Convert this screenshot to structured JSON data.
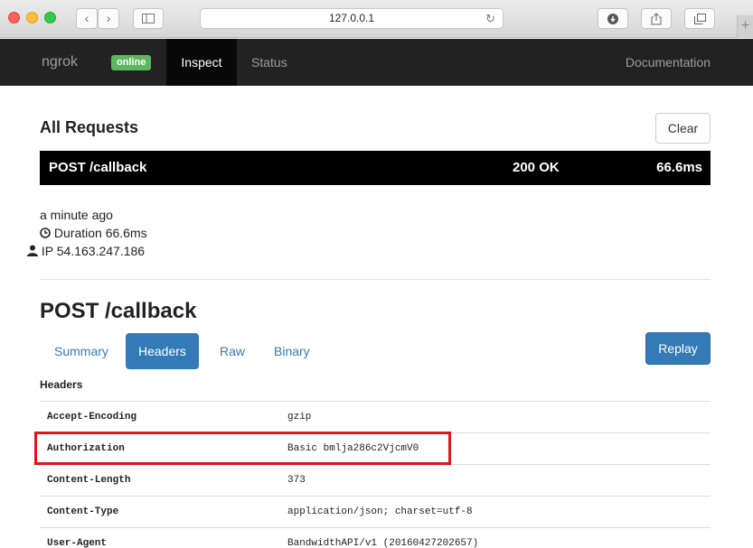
{
  "browser": {
    "address": "127.0.0.1",
    "icons": [
      "back-icon",
      "forward-icon",
      "sidebar-icon",
      "reload-icon",
      "download-icon",
      "share-icon",
      "tabs-icon",
      "new-tab-icon"
    ]
  },
  "navbar": {
    "brand": "ngrok",
    "status_badge": "online",
    "tabs": [
      "Inspect",
      "Status"
    ],
    "docs": "Documentation"
  },
  "requests": {
    "title": "All Requests",
    "clear_label": "Clear",
    "row": {
      "method_path": "POST /callback",
      "status": "200 OK",
      "duration": "66.6ms"
    },
    "time_ago": "a minute ago",
    "duration_line": "Duration  66.6ms",
    "ip_line": "IP  54.163.247.186"
  },
  "detail": {
    "title": "POST /callback",
    "tabs": [
      "Summary",
      "Headers",
      "Raw",
      "Binary"
    ],
    "active_tab": "Headers",
    "replay_label": "Replay",
    "headers_label": "Headers",
    "headers": [
      {
        "name": "Accept-Encoding",
        "value": "gzip"
      },
      {
        "name": "Authorization",
        "value": "Basic bmlja286c2VjcmV0"
      },
      {
        "name": "Content-Length",
        "value": "373"
      },
      {
        "name": "Content-Type",
        "value": "application/json; charset=utf-8"
      },
      {
        "name": "User-Agent",
        "value": "BandwidthAPI/v1 (20160427202657)"
      }
    ],
    "highlight_color": "#e4141b"
  },
  "colors": {
    "accent": "#337ab7",
    "online": "#5cb85c",
    "navbar": "#222222"
  }
}
